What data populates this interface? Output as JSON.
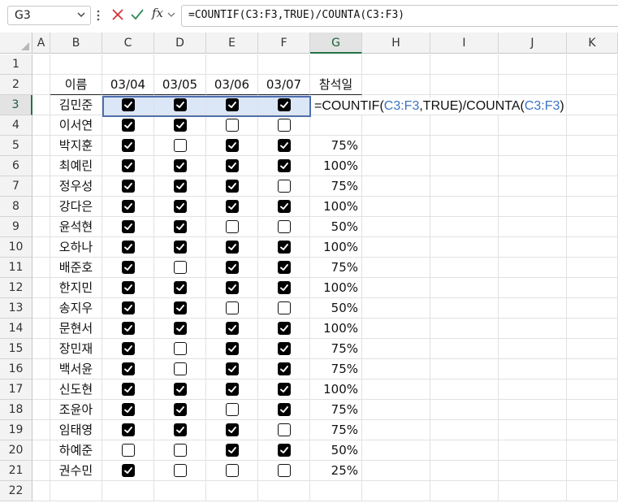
{
  "formula_bar": {
    "name_box": "G3",
    "fx_label": "fx",
    "formula": "=COUNTIF(C3:F3,TRUE)/COUNTA(C3:F3)"
  },
  "edit_formula": {
    "part1": "=COUNTIF(",
    "ref1": "C3:F3",
    "part2": ",TRUE)/COUNTA(",
    "ref2": "C3:F3",
    "part3": ")"
  },
  "columns": [
    "A",
    "B",
    "C",
    "D",
    "E",
    "F",
    "G",
    "H",
    "I",
    "J",
    "K"
  ],
  "row_numbers": [
    "1",
    "2",
    "3",
    "4",
    "5",
    "6",
    "7",
    "8",
    "9",
    "10",
    "11",
    "12",
    "13",
    "14",
    "15",
    "16",
    "17",
    "18",
    "19",
    "20",
    "21",
    "22"
  ],
  "table": {
    "headers": [
      "이름",
      "03/04",
      "03/05",
      "03/06",
      "03/07",
      "참석일"
    ],
    "rows": [
      {
        "name": "김민준",
        "checks": [
          true,
          true,
          true,
          true
        ],
        "rate": ""
      },
      {
        "name": "이서연",
        "checks": [
          true,
          true,
          false,
          false
        ],
        "rate": ""
      },
      {
        "name": "박지훈",
        "checks": [
          true,
          false,
          true,
          true
        ],
        "rate": "75%"
      },
      {
        "name": "최예린",
        "checks": [
          true,
          true,
          true,
          true
        ],
        "rate": "100%"
      },
      {
        "name": "정우성",
        "checks": [
          true,
          true,
          true,
          false
        ],
        "rate": "75%"
      },
      {
        "name": "강다은",
        "checks": [
          true,
          true,
          true,
          true
        ],
        "rate": "100%"
      },
      {
        "name": "윤석현",
        "checks": [
          true,
          true,
          false,
          false
        ],
        "rate": "50%"
      },
      {
        "name": "오하나",
        "checks": [
          true,
          true,
          true,
          true
        ],
        "rate": "100%"
      },
      {
        "name": "배준호",
        "checks": [
          true,
          false,
          true,
          true
        ],
        "rate": "75%"
      },
      {
        "name": "한지민",
        "checks": [
          true,
          true,
          true,
          true
        ],
        "rate": "100%"
      },
      {
        "name": "송지우",
        "checks": [
          true,
          true,
          false,
          false
        ],
        "rate": "50%"
      },
      {
        "name": "문현서",
        "checks": [
          true,
          true,
          true,
          true
        ],
        "rate": "100%"
      },
      {
        "name": "장민재",
        "checks": [
          true,
          false,
          true,
          true
        ],
        "rate": "75%"
      },
      {
        "name": "백서윤",
        "checks": [
          true,
          false,
          true,
          true
        ],
        "rate": "75%"
      },
      {
        "name": "신도현",
        "checks": [
          true,
          true,
          true,
          true
        ],
        "rate": "100%"
      },
      {
        "name": "조윤아",
        "checks": [
          true,
          true,
          false,
          true
        ],
        "rate": "75%"
      },
      {
        "name": "임태영",
        "checks": [
          true,
          true,
          true,
          false
        ],
        "rate": "75%"
      },
      {
        "name": "하예준",
        "checks": [
          false,
          false,
          true,
          true
        ],
        "rate": "50%"
      },
      {
        "name": "권수민",
        "checks": [
          true,
          false,
          false,
          false
        ],
        "rate": "25%"
      }
    ]
  },
  "colors": {
    "selection_fill": "#dbe6f7",
    "selection_border": "#4f6fae",
    "header_accent": "#217346",
    "ref_color": "#3a73c4"
  }
}
